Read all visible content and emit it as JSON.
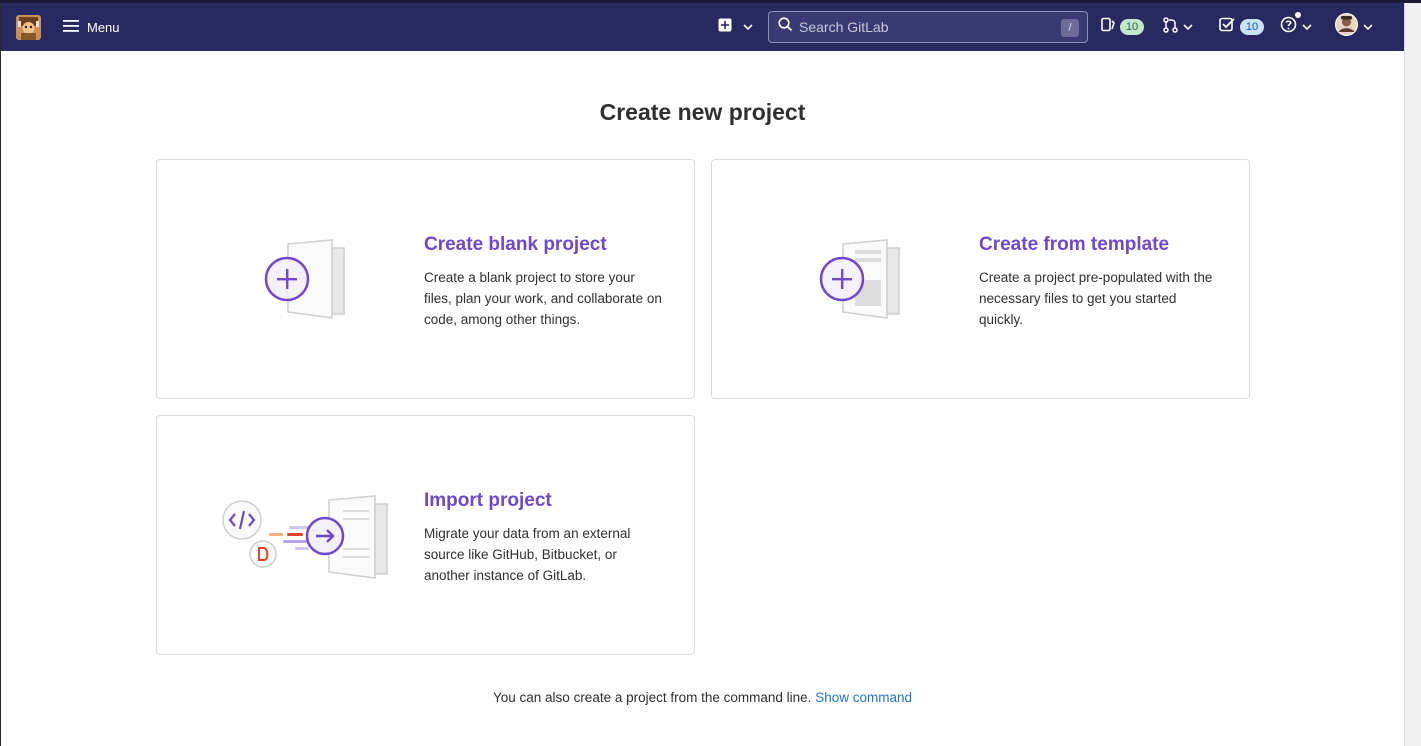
{
  "navbar": {
    "menu_label": "Menu",
    "search": {
      "placeholder": "Search GitLab",
      "shortcut": "/"
    },
    "issues_count": "10",
    "todos_count": "10",
    "colors": {
      "background": "#292961",
      "accent": "#6e49cb"
    }
  },
  "icons": {
    "logo": "tanuki-avatar-icon",
    "menu": "hamburger-icon",
    "new": "plus-square-icon",
    "issues": "issues-icon",
    "merge_requests": "merge-request-icon",
    "todos": "todo-check-icon",
    "help": "question-icon",
    "avatar": "user-avatar-icon"
  },
  "page": {
    "title": "Create new project",
    "cards": [
      {
        "title": "Create blank project",
        "description": "Create a blank project to store your files, plan your work, and collaborate on code, among other things."
      },
      {
        "title": "Create from template",
        "description": "Create a project pre-populated with the necessary files to get you started quickly."
      },
      {
        "title": "Import project",
        "description": "Migrate your data from an external source like GitHub, Bitbucket, or another instance of GitLab."
      }
    ],
    "footer_text": "You can also create a project from the command line.",
    "footer_link": "Show command"
  }
}
